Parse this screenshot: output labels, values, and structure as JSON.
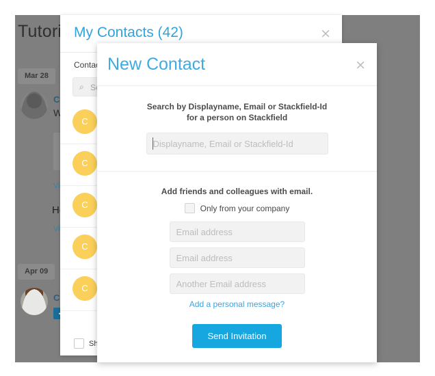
{
  "app": {
    "page_title": "Tutorial",
    "feed": {
      "date_chips": [
        "Mar 28",
        "Apr 09"
      ],
      "items": [
        {
          "name": "Ch",
          "text": "We",
          "link": "Vie"
        },
        {
          "heading": "Ho",
          "link": "Vie"
        },
        {
          "name": "Cri",
          "badge": "✓"
        }
      ]
    }
  },
  "contacts_panel": {
    "title": "My Contacts (42)",
    "close_icon": "×",
    "tab_label": "Contac",
    "search": {
      "icon": "⌕",
      "placeholder": "Sea"
    },
    "rows": [
      {
        "initial": "C"
      },
      {
        "initial": "C"
      },
      {
        "initial": "C"
      },
      {
        "initial": "C"
      },
      {
        "initial": "C"
      }
    ],
    "footer_checkbox_label": "Sh"
  },
  "new_contact": {
    "title": "New Contact",
    "close_icon": "×",
    "search_hint_line1": "Search by Displayname, Email or Stackfield-Id",
    "search_hint_line2": "for a person on Stackfield",
    "search_placeholder": "Displayname, Email or Stackfield-Id",
    "search_value": "",
    "email_section_title": "Add friends and colleagues with email.",
    "company_checkbox_label": "Only from your company",
    "company_checkbox_checked": false,
    "email_fields": [
      {
        "placeholder": "Email address",
        "value": ""
      },
      {
        "placeholder": "Email address",
        "value": ""
      },
      {
        "placeholder": "Another Email address",
        "value": ""
      }
    ],
    "personal_message_link": "Add a personal message?",
    "send_button_label": "Send Invitation"
  },
  "colors": {
    "accent_blue": "#16a7e0",
    "title_blue": "#3faae2",
    "avatar_yellow": "#fad05a",
    "backdrop_gray": "#7f7f7f"
  }
}
